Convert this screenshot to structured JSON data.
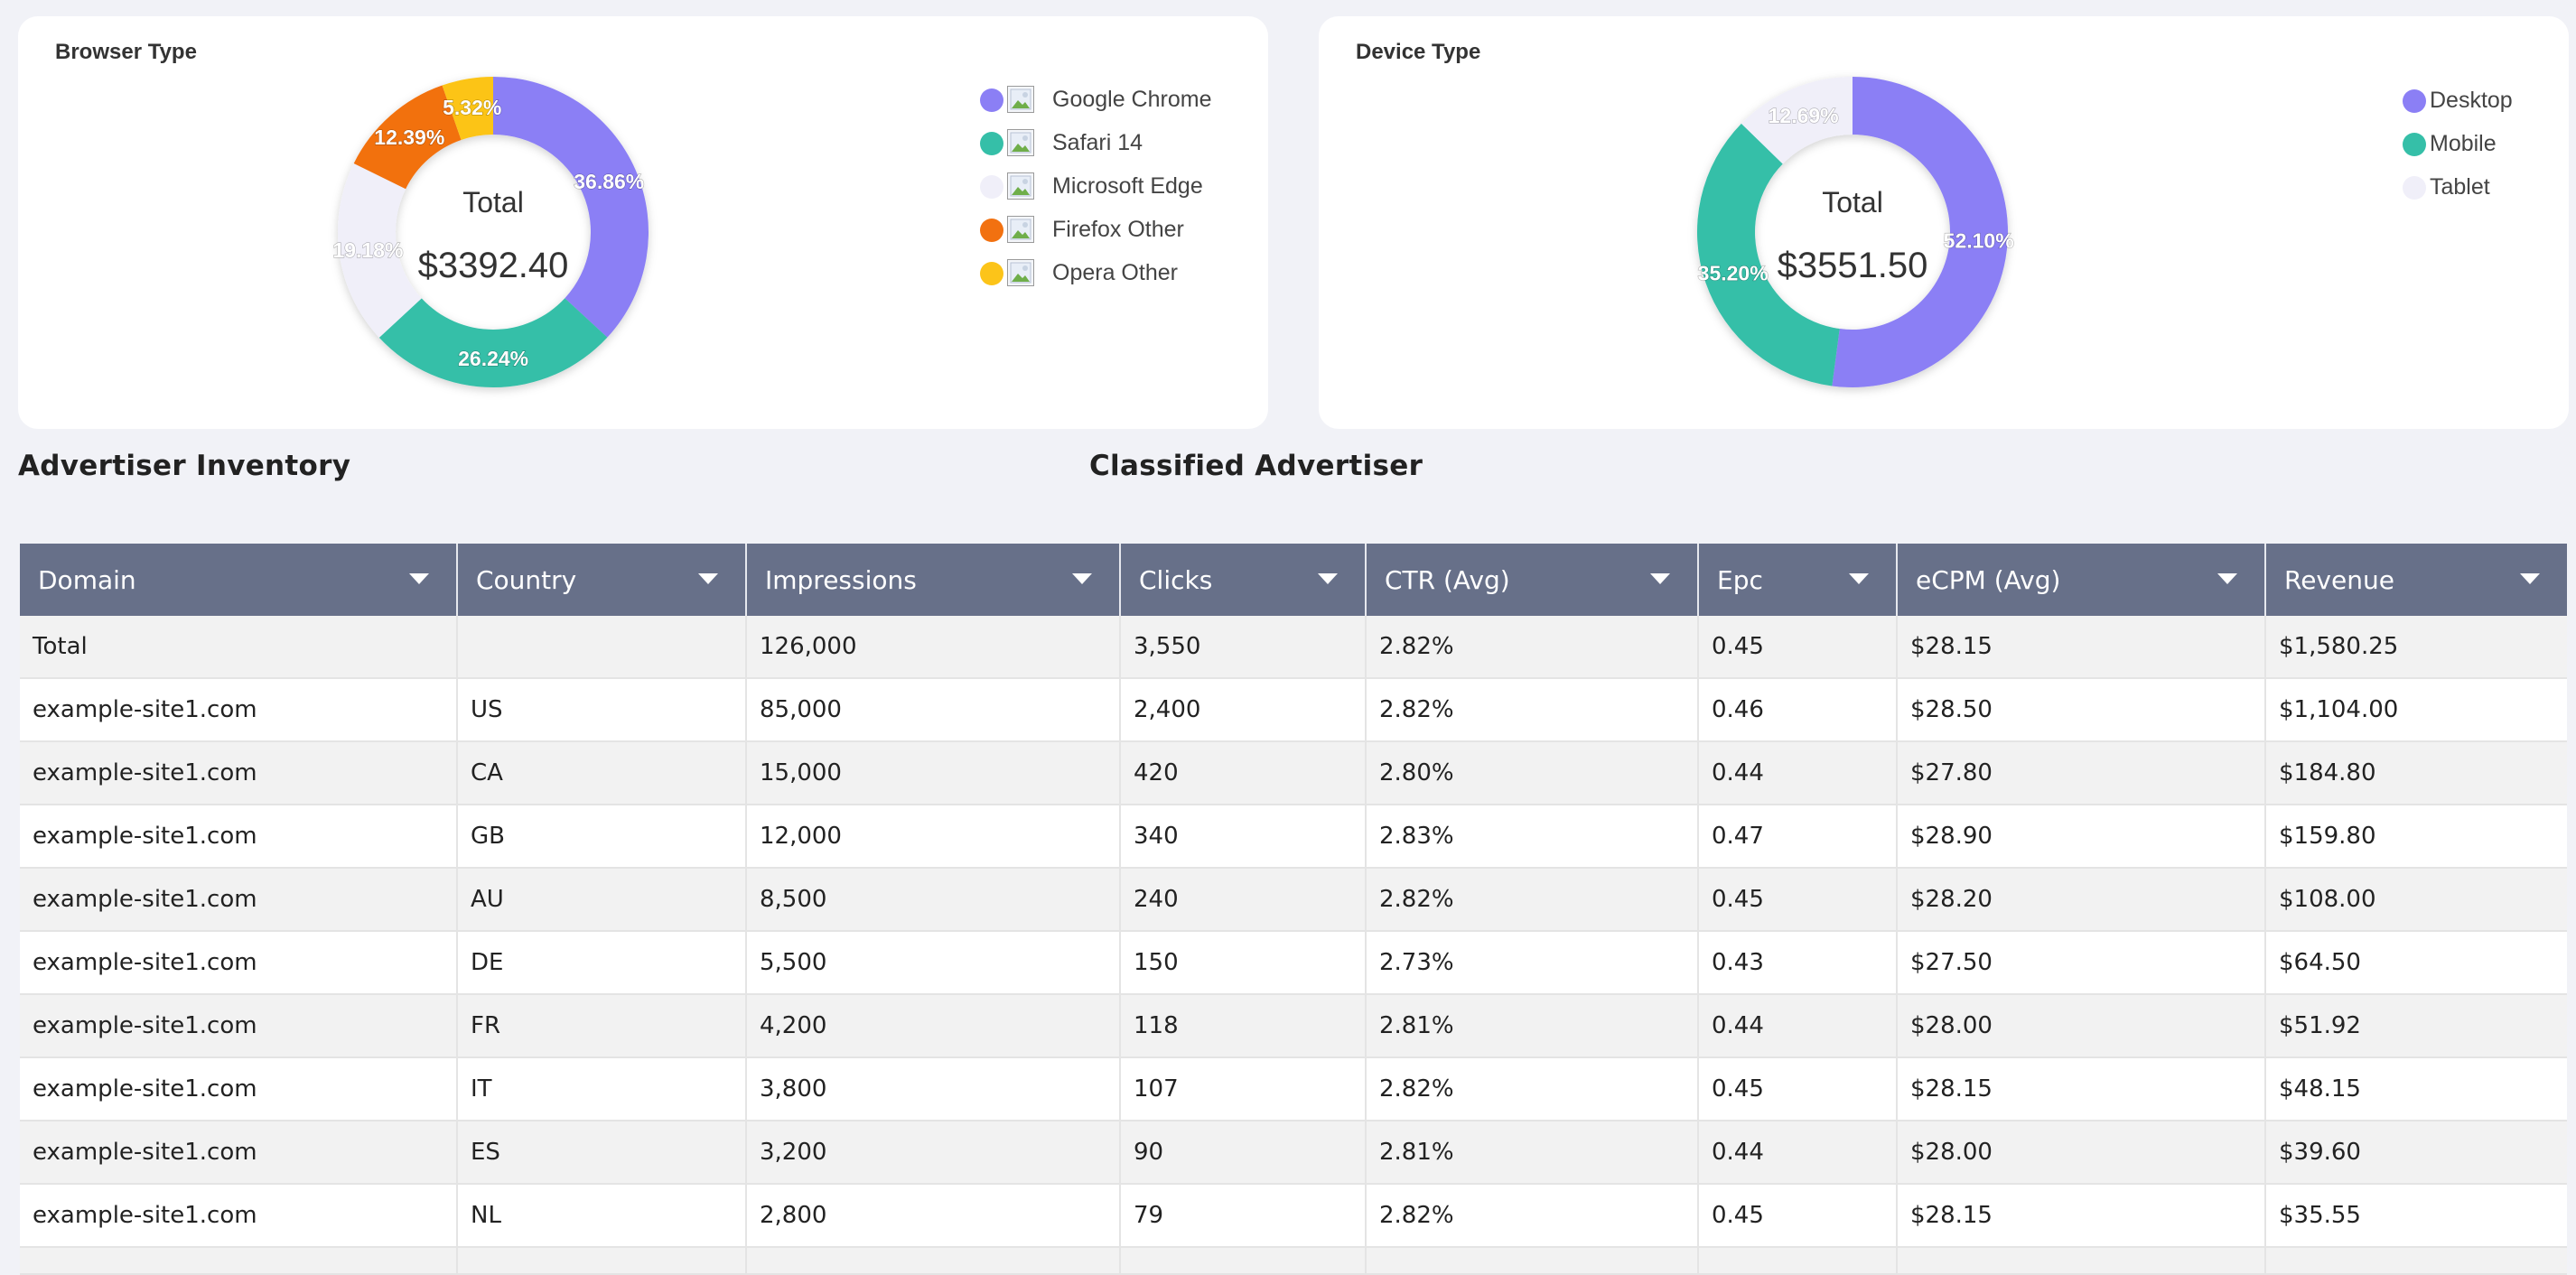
{
  "browser_card": {
    "title": "Browser Type",
    "center_label": "Total",
    "center_value": "$3392.40",
    "legend": [
      {
        "label": "Google Chrome",
        "color": "#8b7ff5"
      },
      {
        "label": "Safari 14",
        "color": "#35bfa8"
      },
      {
        "label": "Microsoft Edge",
        "color": "#f0eff9"
      },
      {
        "label": "Firefox Other",
        "color": "#f27110"
      },
      {
        "label": "Opera Other",
        "color": "#fcc419"
      }
    ]
  },
  "device_card": {
    "title": "Device Type",
    "center_label": "Total",
    "center_value": "$3551.50",
    "legend": [
      {
        "label": "Desktop",
        "color": "#8b7ff5"
      },
      {
        "label": "Mobile",
        "color": "#35bfa8"
      },
      {
        "label": "Tablet",
        "color": "#f0eff9"
      }
    ]
  },
  "chart_data": [
    {
      "type": "pie",
      "title": "Browser Type",
      "categories": [
        "Google Chrome",
        "Safari 14",
        "Microsoft Edge",
        "Firefox Other",
        "Opera Other"
      ],
      "values": [
        36.86,
        26.24,
        19.18,
        12.39,
        5.32
      ],
      "labels": [
        "36.86%",
        "26.24%",
        "19.18%",
        "12.39%",
        "5.32%"
      ],
      "colors": [
        "#8b7ff5",
        "#35bfa8",
        "#f0eff9",
        "#f27110",
        "#fcc419"
      ],
      "legend": "right"
    },
    {
      "type": "pie",
      "title": "Device Type",
      "categories": [
        "Desktop",
        "Mobile",
        "Tablet"
      ],
      "values": [
        52.1,
        35.2,
        12.69
      ],
      "labels": [
        "52.10%",
        "35.20%",
        "12.69%"
      ],
      "colors": [
        "#8b7ff5",
        "#35bfa8",
        "#f0eff9"
      ],
      "legend": "top-right"
    }
  ],
  "sections": {
    "advertiser_inventory": "Advertiser Inventory",
    "classified_advertiser": "Classified Advertiser"
  },
  "table": {
    "header_color": "#677089",
    "columns": [
      "Domain",
      "Country",
      "Impressions",
      "Clicks",
      "CTR (Avg)",
      "Epc",
      "eCPM (Avg)",
      "Revenue"
    ],
    "rows": [
      [
        "Total",
        "",
        "126,000",
        "3,550",
        "2.82%",
        "0.45",
        "$28.15",
        "$1,580.25"
      ],
      [
        "example-site1.com",
        "US",
        "85,000",
        "2,400",
        "2.82%",
        "0.46",
        "$28.50",
        "$1,104.00"
      ],
      [
        "example-site1.com",
        "CA",
        "15,000",
        "420",
        "2.80%",
        "0.44",
        "$27.80",
        "$184.80"
      ],
      [
        "example-site1.com",
        "GB",
        "12,000",
        "340",
        "2.83%",
        "0.47",
        "$28.90",
        "$159.80"
      ],
      [
        "example-site1.com",
        "AU",
        "8,500",
        "240",
        "2.82%",
        "0.45",
        "$28.20",
        "$108.00"
      ],
      [
        "example-site1.com",
        "DE",
        "5,500",
        "150",
        "2.73%",
        "0.43",
        "$27.50",
        "$64.50"
      ],
      [
        "example-site1.com",
        "FR",
        "4,200",
        "118",
        "2.81%",
        "0.44",
        "$28.00",
        "$51.92"
      ],
      [
        "example-site1.com",
        "IT",
        "3,800",
        "107",
        "2.82%",
        "0.45",
        "$28.15",
        "$48.15"
      ],
      [
        "example-site1.com",
        "ES",
        "3,200",
        "90",
        "2.81%",
        "0.44",
        "$28.00",
        "$39.60"
      ],
      [
        "example-site1.com",
        "NL",
        "2,800",
        "79",
        "2.82%",
        "0.45",
        "$28.15",
        "$35.55"
      ]
    ]
  }
}
